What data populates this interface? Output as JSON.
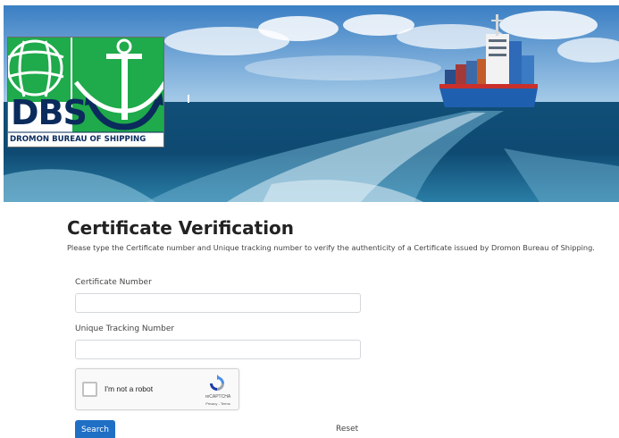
{
  "logo": {
    "mark": "DBS",
    "name": "DROMON BUREAU OF SHIPPING"
  },
  "page": {
    "title": "Certificate Verification",
    "description": "Please type the Certificate number and Unique tracking number to verify the authenticity of a Certificate issued by Dromon Bureau of Shipping."
  },
  "form": {
    "certificate_number": {
      "label": "Certificate Number",
      "value": ""
    },
    "tracking_number": {
      "label": "Unique Tracking Number",
      "value": ""
    },
    "recaptcha": {
      "label": "I'm not a robot",
      "brand": "reCAPTCHA",
      "terms": "Privacy - Terms",
      "icon": "recaptcha-icon"
    },
    "search_label": "Search",
    "reset_label": "Reset"
  },
  "colors": {
    "primary_button": "#1f6fc5",
    "logo_green": "#1faa4b",
    "logo_navy": "#0a2b5c"
  }
}
